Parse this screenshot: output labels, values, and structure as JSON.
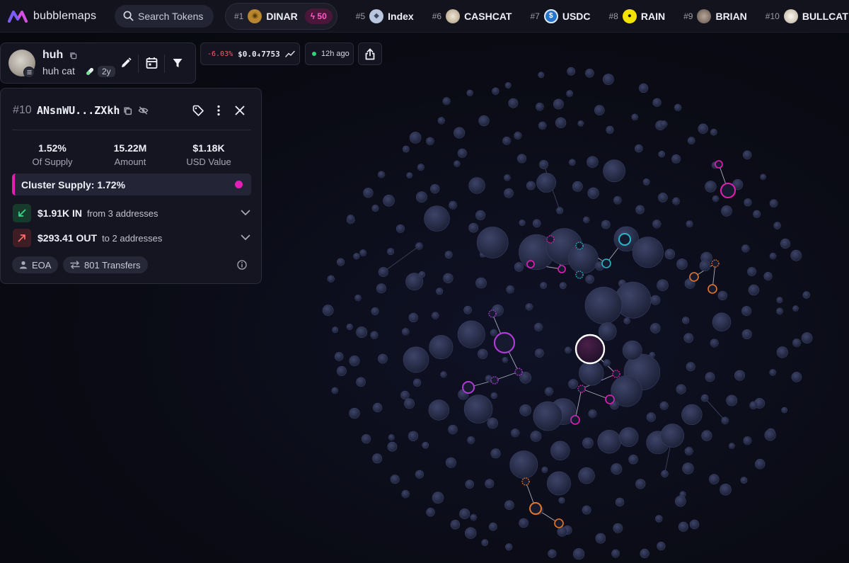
{
  "brand": {
    "name": "bubblemaps"
  },
  "search": {
    "label": "Search Tokens"
  },
  "ranking": [
    {
      "rank": "#1",
      "name": "DINAR",
      "boost": "50",
      "coin_color": "#b8862e",
      "coin_glyph": "◉"
    },
    {
      "rank": "#5",
      "name": "Index",
      "coin_color": "#b9c6dd",
      "coin_glyph": "◆"
    },
    {
      "rank": "#6",
      "name": "CASHCAT",
      "coin_color": "#d8cdb8",
      "coin_glyph": "●"
    },
    {
      "rank": "#7",
      "name": "USDC",
      "coin_color": "#2775ca",
      "coin_glyph": "$"
    },
    {
      "rank": "#8",
      "name": "RAIN",
      "coin_color": "#f2e300",
      "coin_glyph": "●"
    },
    {
      "rank": "#9",
      "name": "BRIAN",
      "coin_color": "#8b7b72",
      "coin_glyph": "●"
    },
    {
      "rank": "#10",
      "name": "BULLCAT",
      "coin_color": "#e9e4d8",
      "coin_glyph": "●"
    }
  ],
  "token": {
    "symbol": "huh",
    "name": "huh cat",
    "age": "2y"
  },
  "price": {
    "change": "-6.03%",
    "value": "$0.0₄7753"
  },
  "updated": {
    "label": "12h ago"
  },
  "wallet": {
    "rank": "#10",
    "address": "ANsnWU...ZXkh",
    "stats": {
      "supply": "1.52%",
      "supply_label": "Of Supply",
      "amount": "15.22M",
      "amount_label": "Amount",
      "usd": "$1.18K",
      "usd_label": "USD Value"
    },
    "cluster_supply": "Cluster Supply: 1.72%",
    "cluster_color": "#e21fb7",
    "inflow": {
      "amount": "$1.91K IN",
      "detail": "from 3 addresses"
    },
    "outflow": {
      "amount": "$293.41 OUT",
      "detail": "to 2 addresses"
    },
    "type": "EOA",
    "transfers": "801 Transfers"
  },
  "bubble_colors": {
    "pink": "#e21fb7",
    "cyan": "#27b7c9",
    "orange": "#e5772a",
    "purple": "#b03ad6",
    "neutral": "#2b3150"
  }
}
